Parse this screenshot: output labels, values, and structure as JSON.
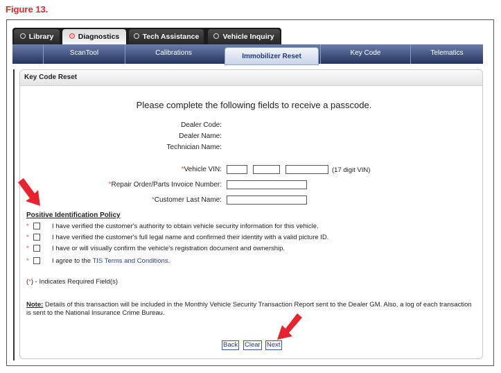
{
  "figure_title": "Figure 13.",
  "main_tabs": [
    {
      "label": "Library"
    },
    {
      "label": "Diagnostics"
    },
    {
      "label": "Tech Assistance"
    },
    {
      "label": "Vehicle Inquiry"
    }
  ],
  "sub_tabs": [
    {
      "label": "ScanTool"
    },
    {
      "label": "Calibrations"
    },
    {
      "label": "Immobilizer Reset"
    },
    {
      "label": "Key Code"
    },
    {
      "label": "Telematics"
    }
  ],
  "panel_title": "Key Code Reset",
  "instruction": "Please complete the following fields to receive a passcode.",
  "info": {
    "dealer_code": "Dealer Code:",
    "dealer_name": "Dealer Name:",
    "technician_name": "Technician Name:"
  },
  "fields": {
    "vin_label": "Vehicle VIN:",
    "vin_hint": "(17 digit VIN)",
    "repair_order_label": "Repair Order/Parts Invoice Number:",
    "last_name_label": "Customer Last Name:",
    "required_marker": "*"
  },
  "policy": {
    "title": "Positive Identification Policy",
    "items": [
      "I have verified the customer's authority to obtain vehicle security information for this vehicle.",
      "I have verified the customer's full legal name and confirmed their identity with a valid picture ID.",
      "I have or will visually confirm the vehicle's registration document and ownership."
    ],
    "terms_prefix": "I agree to the ",
    "terms_link": "TIS Terms and Conditions",
    "terms_suffix": "."
  },
  "required_note": {
    "open": "(",
    "marker": "*",
    "close": ") - Indicates Required Field(s)"
  },
  "note": {
    "label": "Note:",
    "text": " Details of this transaction will be included in the Monthly Vehicle Security Transaction Report sent to the Dealer GM. Also, a log of each transaction is sent to the National Insurance Crime Bureau."
  },
  "buttons": {
    "back": "Back",
    "clear": "Clear",
    "next": "Next"
  },
  "colors": {
    "figure_title": "#e8232f",
    "required": "#e04848",
    "nav_blue": "#23345e",
    "arrow": "#e8232f"
  }
}
